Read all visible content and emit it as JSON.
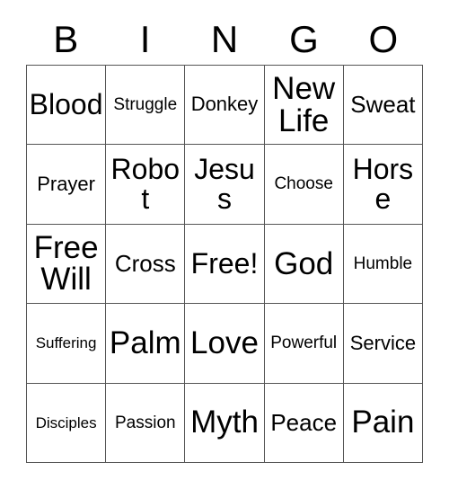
{
  "card": {
    "title": "BINGO",
    "headers": [
      "B",
      "I",
      "N",
      "G",
      "O"
    ],
    "grid_border_color": "#555555",
    "text_color": "#000000",
    "background_color": "#ffffff",
    "rows": [
      [
        {
          "label": "Blood",
          "size": "fs-xxl"
        },
        {
          "label": "Struggle",
          "size": "fs-sm"
        },
        {
          "label": "Donkey",
          "size": "fs-md"
        },
        {
          "label": "New Life",
          "size": "fs-xxxl"
        },
        {
          "label": "Sweat",
          "size": "fs-lg"
        }
      ],
      [
        {
          "label": "Prayer",
          "size": "fs-md"
        },
        {
          "label": "Robot",
          "size": "fs-xxl"
        },
        {
          "label": "Jesus",
          "size": "fs-xxl"
        },
        {
          "label": "Choose",
          "size": "fs-sm"
        },
        {
          "label": "Horse",
          "size": "fs-xxl"
        }
      ],
      [
        {
          "label": "Free Will",
          "size": "fs-xxxl"
        },
        {
          "label": "Cross",
          "size": "fs-lg"
        },
        {
          "label": "Free!",
          "size": "fs-xxl"
        },
        {
          "label": "God",
          "size": "fs-xxxl"
        },
        {
          "label": "Humble",
          "size": "fs-sm"
        }
      ],
      [
        {
          "label": "Suffering",
          "size": "fs-xs"
        },
        {
          "label": "Palm",
          "size": "fs-xxxl"
        },
        {
          "label": "Love",
          "size": "fs-xxxl"
        },
        {
          "label": "Powerful",
          "size": "fs-sm"
        },
        {
          "label": "Service",
          "size": "fs-md"
        }
      ],
      [
        {
          "label": "Disciples",
          "size": "fs-xs"
        },
        {
          "label": "Passion",
          "size": "fs-sm"
        },
        {
          "label": "Myth",
          "size": "fs-xxxl"
        },
        {
          "label": "Peace",
          "size": "fs-lg"
        },
        {
          "label": "Pain",
          "size": "fs-xxxl"
        }
      ]
    ]
  }
}
